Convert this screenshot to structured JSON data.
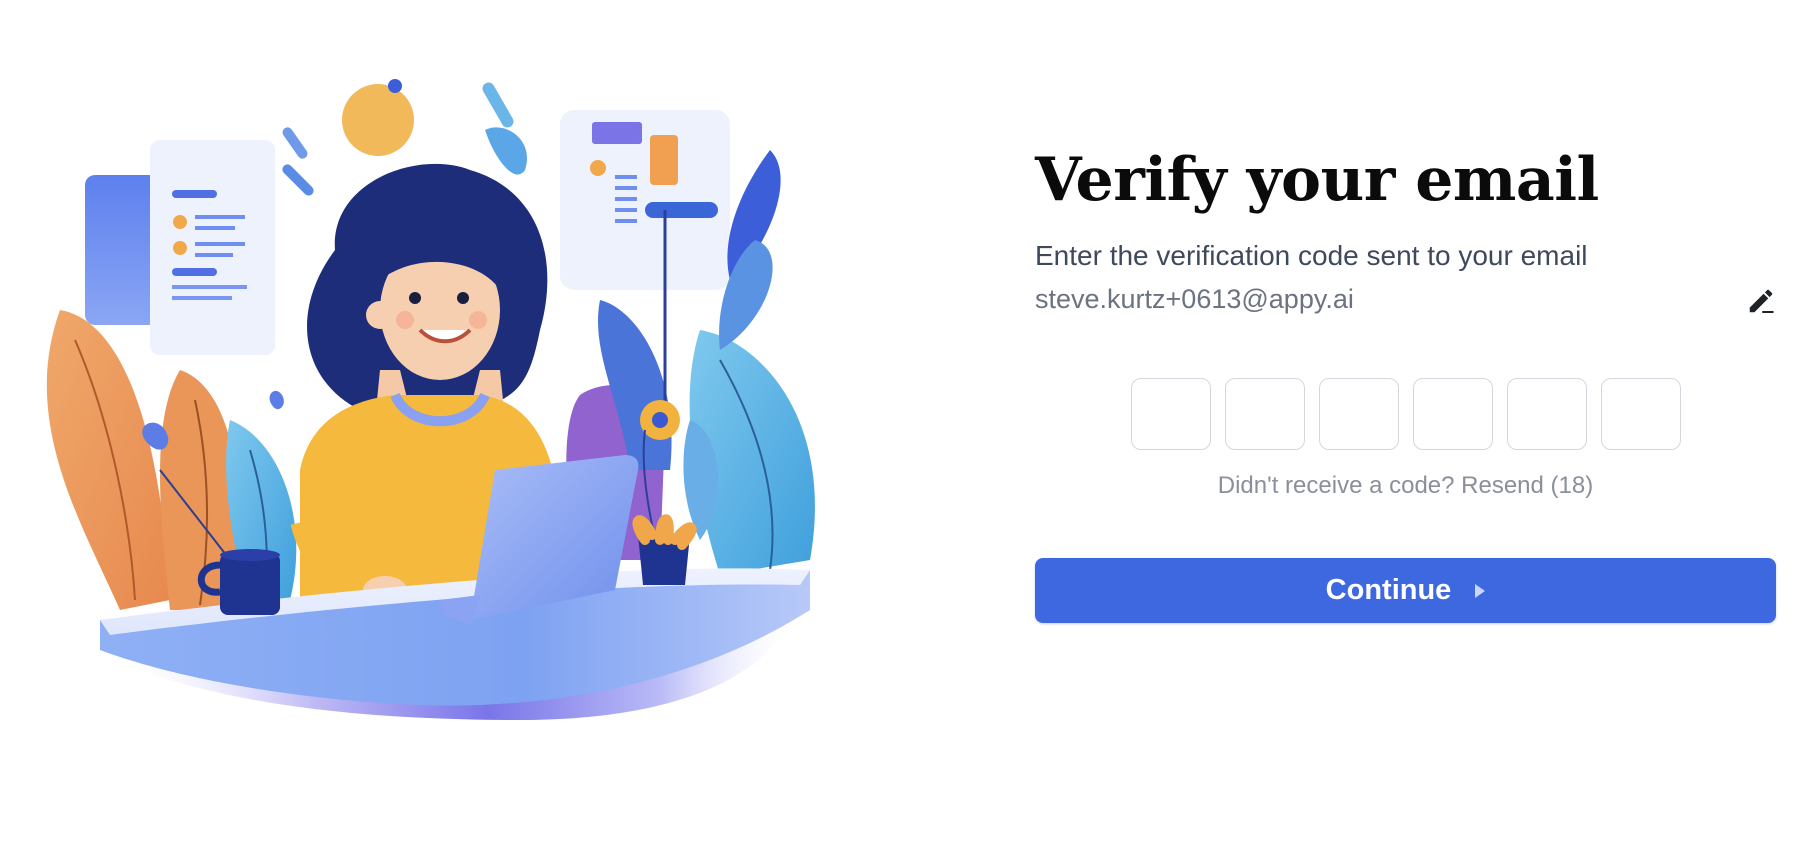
{
  "verify": {
    "title": "Verify your email",
    "subtitle": "Enter the verification code sent to your email",
    "email": "steve.kurtz+0613@appy.ai",
    "edit_icon": "pencil-edit-icon",
    "code_digits": [
      "",
      "",
      "",
      "",
      "",
      ""
    ],
    "resend_prefix": "Didn't receive a code?",
    "resend_link": "Resend (18)",
    "continue_label": "Continue",
    "continue_icon": "play-arrow-icon"
  },
  "colors": {
    "primary_button": "#3e68e0",
    "title": "#0b0b0b",
    "subtitle": "#3e4a5c",
    "muted": "#8a8f99",
    "input_border": "#d4d7dd"
  },
  "illustration": {
    "name": "woman-at-laptop-illustration"
  }
}
